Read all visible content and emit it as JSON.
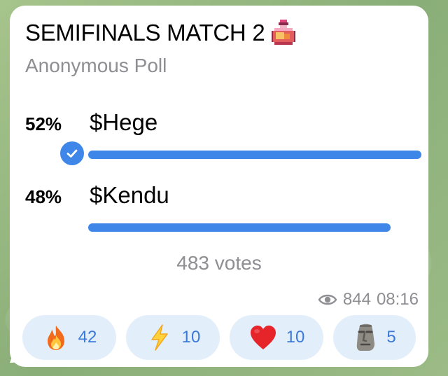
{
  "poll": {
    "title": "SEMIFINALS MATCH 2",
    "title_emoji_icon": "pixel-potion-icon",
    "type_label": "Anonymous Poll",
    "options": [
      {
        "percent_label": "52%",
        "text": "$Hege",
        "fraction": 0.52,
        "chosen": true
      },
      {
        "percent_label": "48%",
        "text": "$Kendu",
        "fraction": 0.48,
        "chosen": false
      }
    ],
    "votes_label": "483 votes"
  },
  "meta": {
    "views": "844",
    "time": "08:16",
    "views_icon": "eye-icon"
  },
  "reactions": [
    {
      "icon": "fire-icon",
      "count": "42"
    },
    {
      "icon": "lightning-icon",
      "count": "10"
    },
    {
      "icon": "red-heart-icon",
      "count": "10"
    },
    {
      "icon": "moai-icon",
      "count": "5"
    }
  ],
  "colors": {
    "accent": "#3e86e8",
    "muted": "#8e8e93",
    "reaction_bg": "#e3eefb",
    "reaction_text": "#3b7ad8"
  }
}
